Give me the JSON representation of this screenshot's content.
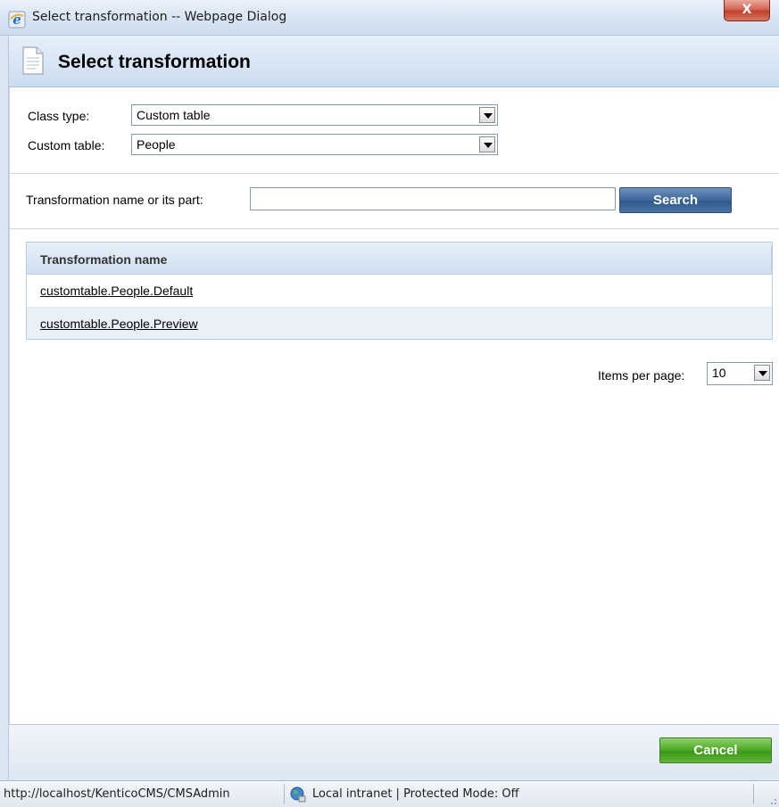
{
  "window": {
    "title": "Select transformation -- Webpage Dialog",
    "close_label": "X"
  },
  "header": {
    "title": "Select transformation"
  },
  "filters": {
    "class_type_label": "Class type:",
    "class_type_value": "Custom table",
    "custom_table_label": "Custom table:",
    "custom_table_value": "People"
  },
  "search": {
    "label": "Transformation name or its part:",
    "value": "",
    "button_label": "Search"
  },
  "grid": {
    "column_header": "Transformation name",
    "rows": [
      "customtable.People.Default",
      "customtable.People.Preview"
    ]
  },
  "pager": {
    "label": "Items per page:",
    "value": "10"
  },
  "footer": {
    "cancel_label": "Cancel"
  },
  "statusbar": {
    "url": "http://localhost/KenticoCMS/CMSAdmin",
    "zone": "Local intranet | Protected Mode: Off"
  },
  "colors": {
    "search_button": "#3c6699",
    "cancel_button": "#4aa824",
    "header_band": "#cbdcf0",
    "close_button": "#c2402a"
  }
}
